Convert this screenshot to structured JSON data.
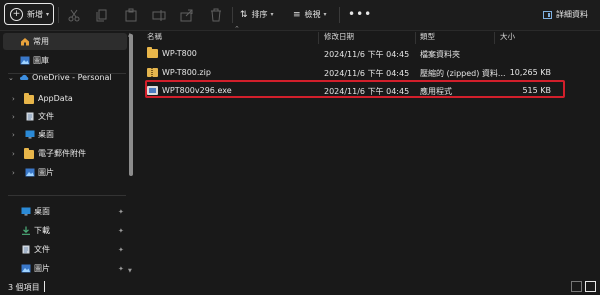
{
  "toolbar": {
    "new_label": "新增",
    "sort_label": "排序",
    "view_label": "檢視",
    "more_label": "•••",
    "details_label": "詳細資料",
    "icons": [
      "cut-icon",
      "copy-icon",
      "paste-icon",
      "rename-icon",
      "share-icon",
      "delete-icon"
    ]
  },
  "sidebar": {
    "top": [
      {
        "label": "常用",
        "icon": "home-icon"
      },
      {
        "label": "圖庫",
        "icon": "gallery-icon"
      }
    ],
    "onedrive": {
      "label": "OneDrive - Personal",
      "icon": "cloud-icon"
    },
    "tree": [
      {
        "label": "AppData",
        "icon": "folder-icon"
      },
      {
        "label": "文件",
        "icon": "documents-icon"
      },
      {
        "label": "桌面",
        "icon": "desktop-icon"
      },
      {
        "label": "電子郵件附件",
        "icon": "folder-icon"
      },
      {
        "label": "圖片",
        "icon": "pictures-icon"
      }
    ],
    "quick": [
      {
        "label": "桌面",
        "icon": "desktop-icon"
      },
      {
        "label": "下載",
        "icon": "download-icon"
      },
      {
        "label": "文件",
        "icon": "documents-icon"
      },
      {
        "label": "圖片",
        "icon": "pictures-icon"
      }
    ]
  },
  "columns": {
    "name": "名稱",
    "date": "修改日期",
    "type": "類型",
    "size": "大小"
  },
  "files": [
    {
      "name": "WP-T800",
      "date": "2024/11/6 下午 04:45",
      "type": "檔案資料夾",
      "size": "",
      "icon": "folder-icon"
    },
    {
      "name": "WP-T800.zip",
      "date": "2024/11/6 下午 04:45",
      "type": "壓縮的 (zipped) 資料...",
      "size": "10,265 KB",
      "icon": "zip-icon"
    },
    {
      "name": "WPT800v296.exe",
      "date": "2024/11/6 下午 04:45",
      "type": "應用程式",
      "size": "515 KB",
      "icon": "exe-icon"
    }
  ],
  "status": {
    "count": "3 個項目"
  },
  "colors": {
    "highlight": "#d21f2b",
    "folder": "#e8b64a",
    "accent": "#4d9ee8"
  }
}
